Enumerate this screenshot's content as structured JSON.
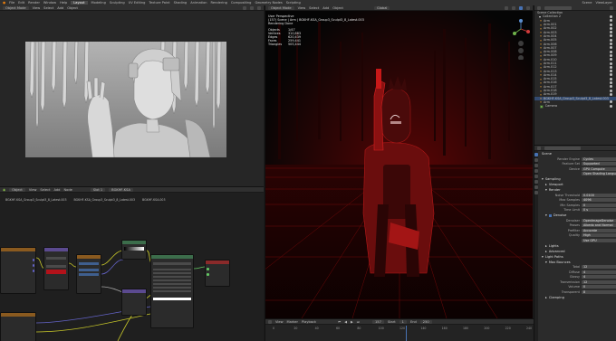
{
  "app": {
    "menus": [
      "File",
      "Edit",
      "Render",
      "Window",
      "Help"
    ],
    "workspaces": [
      "Layout",
      "Modeling",
      "Sculpting",
      "UV Editing",
      "Texture Paint",
      "Shading",
      "Animation",
      "Rendering",
      "Compositing",
      "Geometry Nodes",
      "Scripting"
    ],
    "active_workspace": "Layout",
    "scene": "Scene",
    "view_layer": "ViewLayer"
  },
  "render_view": {
    "mode": "Object Mode",
    "menus": [
      "View",
      "Select",
      "Add",
      "Object"
    ],
    "shading": "Material"
  },
  "node_editor": {
    "type": "Object",
    "menus": [
      "View",
      "Select",
      "Add",
      "Node"
    ],
    "slot": "Slot 1",
    "material": "BGKHF-KSA",
    "breadcrumb": [
      "BGKHF-KSA_Group3_Sculpt3_8_Latest.003",
      "BGKHF-KSA_Group3_Sculpt3_8_Latest.003",
      "BGKHF-KSA.003"
    ]
  },
  "viewport": {
    "mode": "Object Mode",
    "menus": [
      "View",
      "Select",
      "Add",
      "Object"
    ],
    "transform": "Global",
    "overlay_title": "User Perspective",
    "overlay_subtitle": "(157) Scene | Arm | BGKHF-KSA_Group3_Sculpt3_8_Latest.003",
    "overlay_status": "Rendering Done",
    "stats": [
      {
        "k": "Objects",
        "v": "1/47"
      },
      {
        "k": "Vertices",
        "v": "310,883"
      },
      {
        "k": "Edges",
        "v": "620,439"
      },
      {
        "k": "Faces",
        "v": "259,441"
      },
      {
        "k": "Triangles",
        "v": "505,444"
      }
    ]
  },
  "outliner": {
    "header": "Scene Collection",
    "collection": "Collection 2",
    "items": [
      "Arm",
      "Arm.001",
      "Arm.002",
      "Arm.003",
      "Arm.004",
      "Arm.005",
      "Arm.006",
      "Arm.007",
      "Arm.008",
      "Arm.009",
      "Arm.010",
      "Arm.011",
      "Arm.012",
      "Arm.013",
      "Arm.014",
      "Arm.015",
      "Arm.016",
      "Arm.017",
      "Arm.018",
      "Arm.019"
    ],
    "long_item": "BGKHF-KSA_Group3_Sculpt3_8_Latest.003",
    "extra": [
      "Arm",
      "Camera"
    ]
  },
  "properties": {
    "scene_label": "Scene",
    "rows": [
      {
        "k": "Render Engine",
        "v": "Cycles"
      },
      {
        "k": "Feature Set",
        "v": "Supported"
      },
      {
        "k": "Device",
        "v": "GPU Compute"
      },
      {
        "k": "",
        "v": "Open Shading Language"
      }
    ],
    "sampling": "Sampling",
    "viewport_sub": "Viewport",
    "render_sub": "Render",
    "render_rows": [
      {
        "k": "Noise Threshold",
        "v": "0.0100"
      },
      {
        "k": "Max Samples",
        "v": "4096"
      },
      {
        "k": "Min Samples",
        "v": "0"
      },
      {
        "k": "Time Limit",
        "v": "0 s"
      }
    ],
    "denoise": "Denoise",
    "denoise_rows": [
      {
        "k": "Denoiser",
        "v": "OpenImageDenoise"
      },
      {
        "k": "Passes",
        "v": "Albedo and Normal"
      },
      {
        "k": "Prefilter",
        "v": "Accurate"
      },
      {
        "k": "Quality",
        "v": "High"
      },
      {
        "k": "",
        "v": "Use GPU"
      }
    ],
    "lights": "Lights",
    "advanced": "Advanced",
    "light_paths": "Light Paths",
    "max_bounces": "Max Bounces",
    "bounce_rows": [
      {
        "k": "Total",
        "v": "12"
      },
      {
        "k": "Diffuse",
        "v": "4"
      },
      {
        "k": "Glossy",
        "v": "4"
      },
      {
        "k": "Transmission",
        "v": "12"
      },
      {
        "k": "Volume",
        "v": "0"
      },
      {
        "k": "Transparent",
        "v": "8"
      }
    ],
    "clamping": "Clamping"
  },
  "timeline": {
    "menus": [
      "View",
      "Marker",
      "Playback"
    ],
    "current_frame": "157",
    "start_label": "Start",
    "start": "1",
    "end_label": "End",
    "end": "250",
    "ticks": [
      "0",
      "20",
      "40",
      "60",
      "80",
      "100",
      "120",
      "140",
      "160",
      "180",
      "200",
      "220",
      "240"
    ]
  },
  "colors": {
    "accent": "#4772b3",
    "red_light": "#d11a1a"
  }
}
